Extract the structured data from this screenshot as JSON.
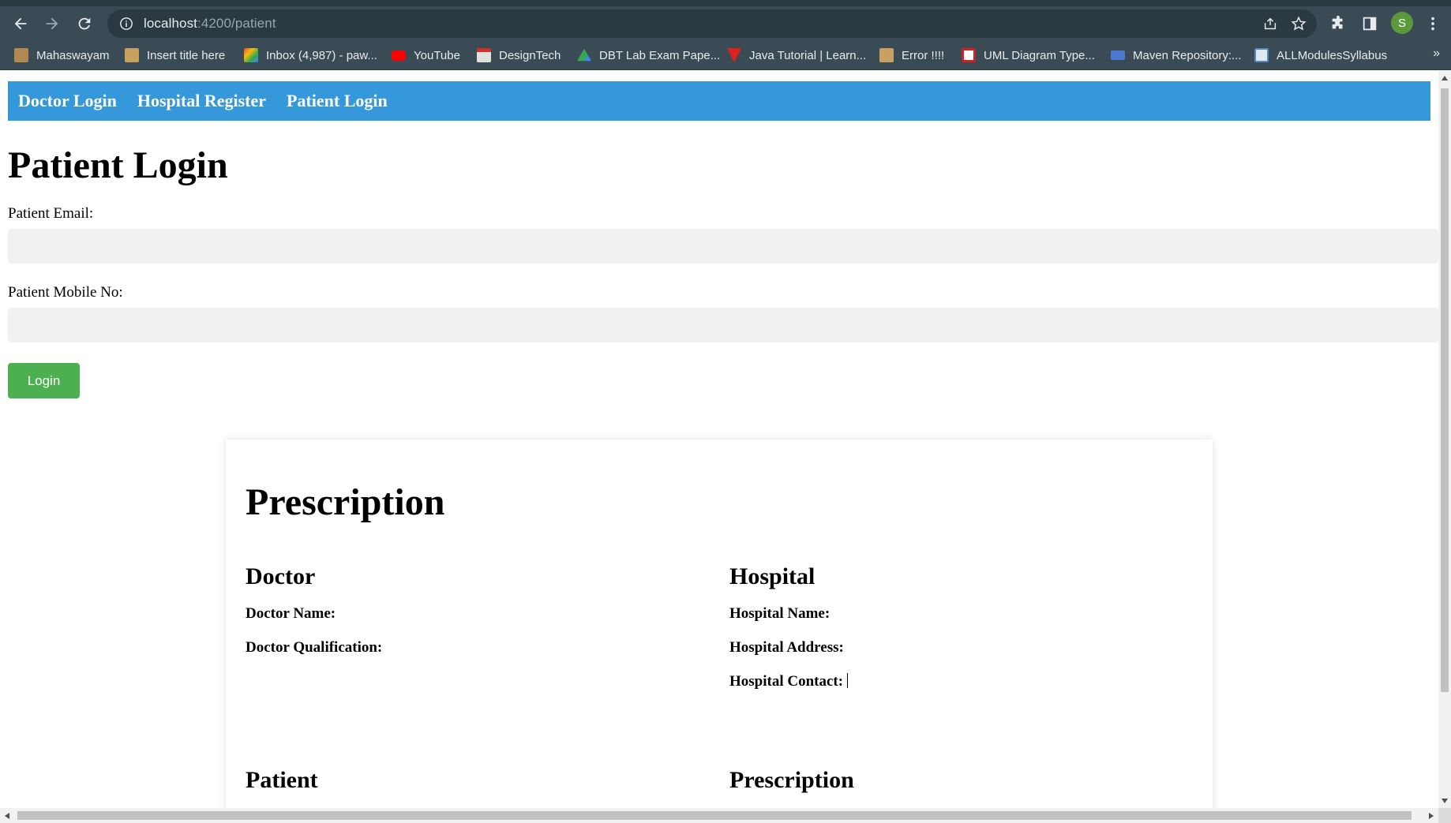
{
  "browser": {
    "url_host": "localhost",
    "url_path": ":4200/patient",
    "profile_initial": "S",
    "bookmarks": [
      {
        "label": "Mahaswayam",
        "icon": "emblem-icon",
        "color": "#b08850"
      },
      {
        "label": "Insert title here",
        "icon": "page-icon",
        "color": "#c8a060"
      },
      {
        "label": "Inbox (4,987) - paw...",
        "icon": "gmail-icon",
        "color": "#ea4335"
      },
      {
        "label": "YouTube",
        "icon": "youtube-icon",
        "color": "#ff0000"
      },
      {
        "label": "DesignTech",
        "icon": "designtech-icon",
        "color": "#e0e0e0"
      },
      {
        "label": "DBT Lab Exam Pape...",
        "icon": "drive-icon",
        "color": "#34a853"
      },
      {
        "label": "Java Tutorial | Learn...",
        "icon": "javatpoint-icon",
        "color": "#e0201a"
      },
      {
        "label": "Error !!!!",
        "icon": "page-icon",
        "color": "#c8a060"
      },
      {
        "label": "UML Diagram Type...",
        "icon": "creately-icon",
        "color": "#ffffff"
      },
      {
        "label": "Maven Repository:...",
        "icon": "maven-icon",
        "color": "#4a7bd0"
      },
      {
        "label": "ALLModulesSyllabus",
        "icon": "doc-icon",
        "color": "#5b86c8"
      }
    ],
    "more_label": "»"
  },
  "nav": {
    "doctor_login": "Doctor Login",
    "hospital_register": "Hospital Register",
    "patient_login": "Patient Login"
  },
  "form": {
    "title": "Patient Login",
    "email_label": "Patient Email:",
    "email_value": "",
    "mobile_label": "Patient Mobile No:",
    "mobile_value": "",
    "login_label": "Login"
  },
  "prescription": {
    "title": "Prescription",
    "doctor": {
      "heading": "Doctor",
      "name_label": "Doctor Name:",
      "qualification_label": "Doctor Qualification:"
    },
    "hospital": {
      "heading": "Hospital",
      "name_label": "Hospital Name:",
      "address_label": "Hospital Address:",
      "contact_label": "Hospital Contact:"
    },
    "patient_heading": "Patient",
    "prescription_heading": "Prescription"
  },
  "colors": {
    "navbar": "#3498db",
    "login_button": "#4caf50",
    "input_bg": "#f1f1f1",
    "chrome_bg": "#3b4b55"
  }
}
